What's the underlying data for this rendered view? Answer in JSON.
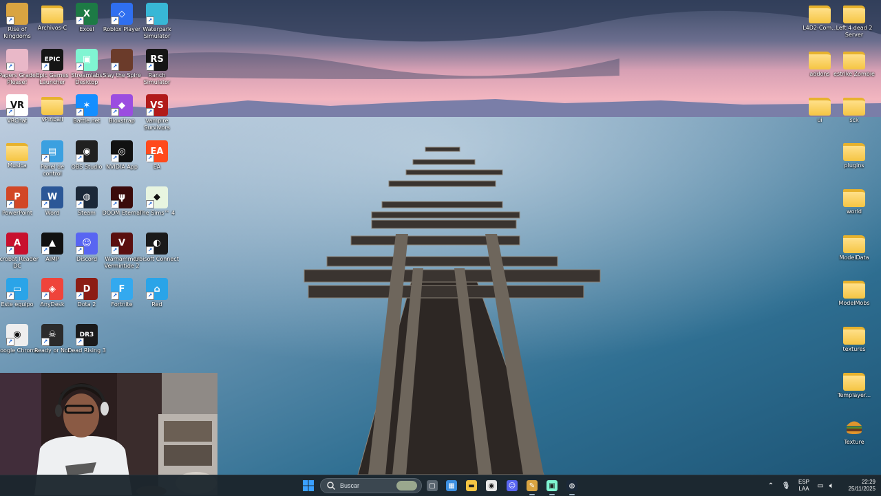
{
  "desktop": {
    "left_icons": [
      {
        "label": "Rise of Kingdoms",
        "icon": "rise-of-kingdoms-icon",
        "color": "#d9a441"
      },
      {
        "label": "Archivos-C",
        "icon": "folder-icon",
        "color": "#f5c543"
      },
      {
        "label": "Excel",
        "icon": "excel-icon",
        "color": "#1d7a45",
        "glyph": "X"
      },
      {
        "label": "Roblox Player",
        "icon": "roblox-icon",
        "color": "#2f6ff0",
        "glyph": "◇"
      },
      {
        "label": "Waterpark Simulator",
        "icon": "waterpark-icon",
        "color": "#38b7d6"
      },
      {
        "label": "Papers Grade Please!",
        "icon": "papers-grade-icon",
        "color": "#e9b8c8"
      },
      {
        "label": "Epic Games Launcher",
        "icon": "epic-games-icon",
        "color": "#151515",
        "glyph": "EPIC"
      },
      {
        "label": "Streamlabs Desktop",
        "icon": "streamlabs-icon",
        "color": "#80f5d2",
        "glyph": "▣"
      },
      {
        "label": "Slay the Spire",
        "icon": "slay-the-spire-icon",
        "color": "#6b3b2a"
      },
      {
        "label": "Ranch Simulator",
        "icon": "ranch-simulator-icon",
        "color": "#151515",
        "glyph": "RS"
      },
      {
        "label": "VRChat",
        "icon": "vrchat-icon",
        "color": "#ffffff",
        "glyph": "VR",
        "dark": true
      },
      {
        "label": "vPinball",
        "icon": "folder-icon",
        "color": "#f5c543"
      },
      {
        "label": "Battle.net",
        "icon": "battlenet-icon",
        "color": "#148eff",
        "glyph": "✶"
      },
      {
        "label": "Bloxstrap",
        "icon": "bloxstrap-icon",
        "color": "#9b4de0",
        "glyph": "◆"
      },
      {
        "label": "Vampire Survivors",
        "icon": "vampire-survivors-icon",
        "color": "#b11a1a",
        "glyph": "VS"
      },
      {
        "label": "Musica",
        "icon": "folder-icon",
        "color": "#f5c543"
      },
      {
        "label": "Panel de control",
        "icon": "control-panel-icon",
        "color": "#3ba0e0",
        "glyph": "▤"
      },
      {
        "label": "OBS Studio",
        "icon": "obs-studio-icon",
        "color": "#202020",
        "glyph": "◉"
      },
      {
        "label": "NVIDIA App",
        "icon": "nvidia-icon",
        "color": "#111111",
        "glyph": "◎"
      },
      {
        "label": "EA",
        "icon": "ea-icon",
        "color": "#ff4a1c",
        "glyph": "EA"
      },
      {
        "label": "PowerPoint",
        "icon": "powerpoint-icon",
        "color": "#d24726",
        "glyph": "P"
      },
      {
        "label": "Word",
        "icon": "word-icon",
        "color": "#2b5797",
        "glyph": "W"
      },
      {
        "label": "Steam",
        "icon": "steam-icon",
        "color": "#1b2838",
        "glyph": "◍"
      },
      {
        "label": "DOOM Eternal",
        "icon": "doom-eternal-icon",
        "color": "#3a0a0a",
        "glyph": "ψ"
      },
      {
        "label": "The Sims™ 4",
        "icon": "sims-4-icon",
        "color": "#e8f5e0",
        "glyph": "◆",
        "dark": true
      },
      {
        "label": "Acrobat Reader DC",
        "icon": "acrobat-icon",
        "color": "#c8102e",
        "glyph": "A"
      },
      {
        "label": "AIMP",
        "icon": "aimp-icon",
        "color": "#111111",
        "glyph": "▲"
      },
      {
        "label": "Discord",
        "icon": "discord-icon",
        "color": "#5865f2",
        "glyph": "☺"
      },
      {
        "label": "Warhammer Vermintide 2",
        "icon": "vermintide-icon",
        "color": "#5a0f0f",
        "glyph": "V"
      },
      {
        "label": "Ubisoft Connect",
        "icon": "ubisoft-icon",
        "color": "#1a1a1a",
        "glyph": "◐"
      },
      {
        "label": "Este equipo",
        "icon": "computer-icon",
        "color": "#2aa4e8",
        "glyph": "▭"
      },
      {
        "label": "AnyDesk",
        "icon": "anydesk-icon",
        "color": "#ef443b",
        "glyph": "◈"
      },
      {
        "label": "Dota 2",
        "icon": "dota2-icon",
        "color": "#8c1d14",
        "glyph": "D"
      },
      {
        "label": "Fortnite",
        "icon": "fortnite-icon",
        "color": "#33a9ef",
        "glyph": "F"
      },
      {
        "label": "Red",
        "icon": "network-icon",
        "color": "#2aa4e8",
        "glyph": "⌂"
      },
      {
        "label": "Google Chrome",
        "icon": "chrome-icon",
        "color": "#eeeeee",
        "glyph": "◉",
        "dark": true
      },
      {
        "label": "Ready or Not",
        "icon": "ready-or-not-icon",
        "color": "#2b2b2b",
        "glyph": "☠"
      },
      {
        "label": "Dead Rising 3",
        "icon": "dead-rising-3-icon",
        "color": "#1a1a1a",
        "glyph": "DR3"
      }
    ],
    "right_icons": [
      {
        "label": "L4D2-Com...",
        "icon": "folder-icon"
      },
      {
        "label": "Left 4 dead 2 Server",
        "icon": "folder-icon"
      },
      {
        "label": "addons",
        "icon": "folder-icon"
      },
      {
        "label": "estrike Zombie",
        "icon": "folder-icon"
      },
      {
        "label": "ui",
        "icon": "folder-icon"
      },
      {
        "label": "sck",
        "icon": "folder-icon"
      },
      {
        "label": "plugins",
        "icon": "folder-icon"
      },
      {
        "label": "world",
        "icon": "folder-icon"
      },
      {
        "label": "ModelData",
        "icon": "folder-icon"
      },
      {
        "label": "ModelMobs",
        "icon": "folder-icon"
      },
      {
        "label": "textures",
        "icon": "folder-icon"
      },
      {
        "label": "Templayer...",
        "icon": "folder-icon"
      },
      {
        "label": "Texture",
        "icon": "burger-icon"
      }
    ]
  },
  "taskbar": {
    "search_placeholder": "Buscar",
    "apps": [
      {
        "icon": "task-view-icon",
        "color": "#5a6670",
        "glyph": "▢"
      },
      {
        "icon": "microsoft-store-icon",
        "color": "#3c8fe0",
        "glyph": "▦"
      },
      {
        "icon": "file-explorer-icon",
        "color": "#f5c543",
        "glyph": "▬"
      },
      {
        "icon": "chrome-icon",
        "color": "#e9e9e9",
        "glyph": "◉"
      },
      {
        "icon": "discord-icon",
        "color": "#5865f2",
        "glyph": "☺"
      },
      {
        "icon": "paint-icon",
        "color": "#d9a441",
        "glyph": "✎"
      },
      {
        "icon": "streamlabs-icon",
        "color": "#80f5d2",
        "glyph": "▣"
      },
      {
        "icon": "steam-icon",
        "color": "#1b2838",
        "glyph": "◍"
      }
    ],
    "language_line1": "ESP",
    "language_line2": "LAA",
    "time": "22:29",
    "date": "25/11/2025"
  },
  "colors": {
    "folder": "#f5c543",
    "taskbar": "#1c262e",
    "windows_blue": "#3aa0ff"
  }
}
